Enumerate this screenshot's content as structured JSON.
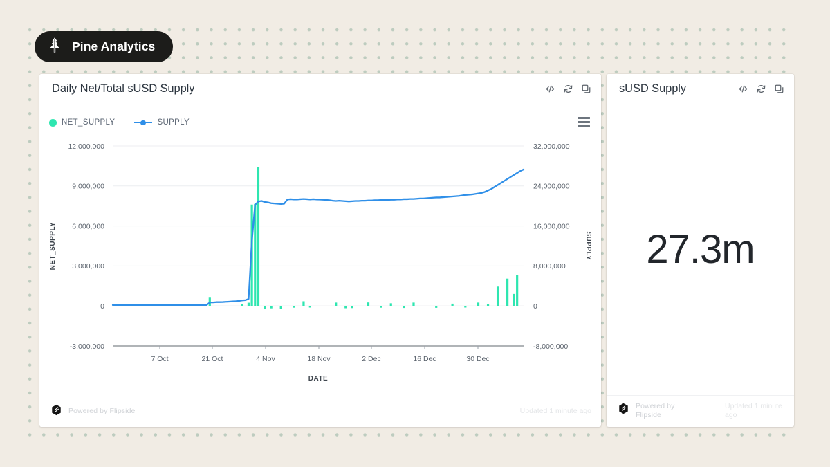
{
  "brand": {
    "name": "Pine Analytics",
    "icon": "pine-tree-icon",
    "pill_bg": "#1c1c1a",
    "text_color": "#ffffff"
  },
  "background": {
    "page_color": "#f1ece4",
    "dot_color": "#b4c6b8"
  },
  "chart_panel": {
    "title": "Daily Net/Total sUSD Supply",
    "header_icons": [
      "code-icon",
      "refresh-icon",
      "copy-icon"
    ],
    "menu_icon": "hamburger-menu-icon",
    "footer": {
      "powered_by": "Powered by Flipside",
      "updated": "Updated 1 minute ago",
      "logo_icon": "flipside-logo-icon"
    }
  },
  "kpi_panel": {
    "title": "sUSD Supply",
    "header_icons": [
      "code-icon",
      "refresh-icon",
      "copy-icon"
    ],
    "value": "27.3m",
    "footer": {
      "powered_by": "Powered by Flipside",
      "updated": "Updated 1 minute ago",
      "logo_icon": "flipside-logo-icon"
    }
  },
  "chart_data": {
    "type": "bar",
    "title": "Daily Net/Total sUSD Supply",
    "xlabel": "DATE",
    "grid": true,
    "legend_position": "top-left",
    "colors": {
      "net_supply": "#2ee6b0",
      "supply": "#2f8fe8"
    },
    "x_tick_labels": [
      "7 Oct",
      "21 Oct",
      "4 Nov",
      "18 Nov",
      "2 Dec",
      "16 Dec",
      "30 Dec"
    ],
    "x_tick_positions": [
      231,
      307,
      384,
      461,
      537,
      614,
      691
    ],
    "left_axis": {
      "name": "NET_SUPPLY",
      "ylim": [
        -3000000,
        12000000
      ],
      "ticks": [
        12000000,
        9000000,
        6000000,
        3000000,
        0,
        -3000000
      ],
      "tick_labels": [
        "12,000,000",
        "9,000,000",
        "6,000,000",
        "3,000,000",
        "0",
        "-3,000,000"
      ]
    },
    "right_axis": {
      "name": "SUPPLY",
      "ylim": [
        -8000000,
        32000000
      ],
      "ticks": [
        32000000,
        24000000,
        16000000,
        8000000,
        0,
        -8000000
      ],
      "tick_labels": [
        "32,000,000",
        "24,000,000",
        "16,000,000",
        "8,000,000",
        "0",
        "-8,000,000"
      ]
    },
    "series": [
      {
        "name": "NET_SUPPLY",
        "type": "bar",
        "axis": "left",
        "color": "#2ee6b0",
        "values": [
          0,
          0,
          0,
          0,
          0,
          0,
          0,
          0,
          0,
          0,
          0,
          0,
          0,
          0,
          0,
          0,
          0,
          0,
          0,
          0,
          0,
          0,
          0,
          0,
          0,
          0,
          0,
          0,
          0,
          0,
          620000,
          0,
          0,
          0,
          0,
          0,
          0,
          0,
          0,
          0,
          120000,
          0,
          240000,
          7600000,
          7650000,
          10400000,
          0,
          -250000,
          0,
          -180000,
          0,
          0,
          -210000,
          0,
          0,
          0,
          -130000,
          0,
          0,
          350000,
          0,
          -120000,
          0,
          0,
          0,
          0,
          0,
          0,
          0,
          250000,
          0,
          0,
          -170000,
          0,
          -160000,
          0,
          0,
          0,
          0,
          260000,
          0,
          0,
          0,
          -130000,
          0,
          0,
          200000,
          0,
          0,
          0,
          -150000,
          0,
          0,
          250000,
          0,
          0,
          0,
          0,
          0,
          0,
          -140000,
          0,
          0,
          0,
          0,
          170000,
          0,
          0,
          0,
          -120000,
          0,
          0,
          0,
          250000,
          0,
          0,
          130000,
          0,
          0,
          1450000,
          0,
          0,
          2050000,
          0,
          900000,
          2300000
        ]
      },
      {
        "name": "SUPPLY",
        "type": "line",
        "axis": "right",
        "color": "#2f8fe8",
        "values": [
          180000,
          180000,
          180000,
          180000,
          180000,
          180000,
          180000,
          180000,
          180000,
          180000,
          180000,
          180000,
          180000,
          180000,
          180000,
          180000,
          180000,
          180000,
          180000,
          180000,
          180000,
          180000,
          180000,
          180000,
          180000,
          180000,
          180000,
          180000,
          180000,
          180000,
          700000,
          700000,
          760000,
          760000,
          780000,
          820000,
          860000,
          900000,
          940000,
          1000000,
          1100000,
          1150000,
          1400000,
          13000000,
          20200000,
          20900000,
          21000000,
          20800000,
          20700000,
          20550000,
          20500000,
          20450000,
          20400000,
          20450000,
          21300000,
          21350000,
          21300000,
          21300000,
          21350000,
          21400000,
          21350000,
          21300000,
          21350000,
          21300000,
          21280000,
          21250000,
          21200000,
          21150000,
          21050000,
          21000000,
          21050000,
          21000000,
          20950000,
          20900000,
          20950000,
          21000000,
          21000000,
          21050000,
          21050000,
          21100000,
          21100000,
          21150000,
          21150000,
          21200000,
          21200000,
          21200000,
          21250000,
          21250000,
          21300000,
          21300000,
          21350000,
          21350000,
          21400000,
          21400000,
          21450000,
          21500000,
          21500000,
          21550000,
          21600000,
          21650000,
          21700000,
          21700000,
          21750000,
          21800000,
          21850000,
          21900000,
          21950000,
          22000000,
          22100000,
          22200000,
          22250000,
          22300000,
          22400000,
          22500000,
          22600000,
          22800000,
          23100000,
          23400000,
          23800000,
          24200000,
          24600000,
          25000000,
          25400000,
          25800000,
          26200000,
          26600000,
          27000000,
          27300000
        ]
      }
    ]
  }
}
